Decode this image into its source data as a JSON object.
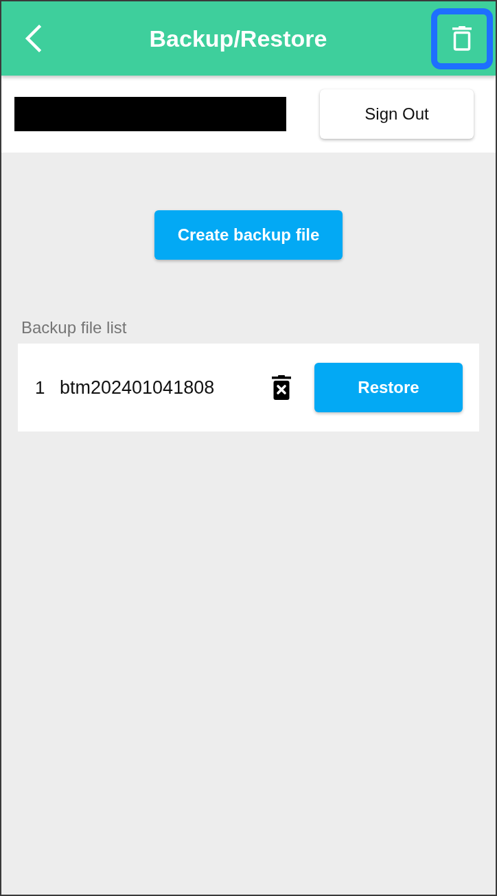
{
  "header": {
    "title": "Backup/Restore",
    "delete_button": {
      "highlighted": true
    }
  },
  "account": {
    "sign_out_button": "Sign Out"
  },
  "create_button": "Create backup file",
  "backup_list": {
    "label": "Backup file list",
    "rows": [
      {
        "index": "1",
        "name": "btm202401041808",
        "restore_button": "Restore"
      }
    ]
  }
}
